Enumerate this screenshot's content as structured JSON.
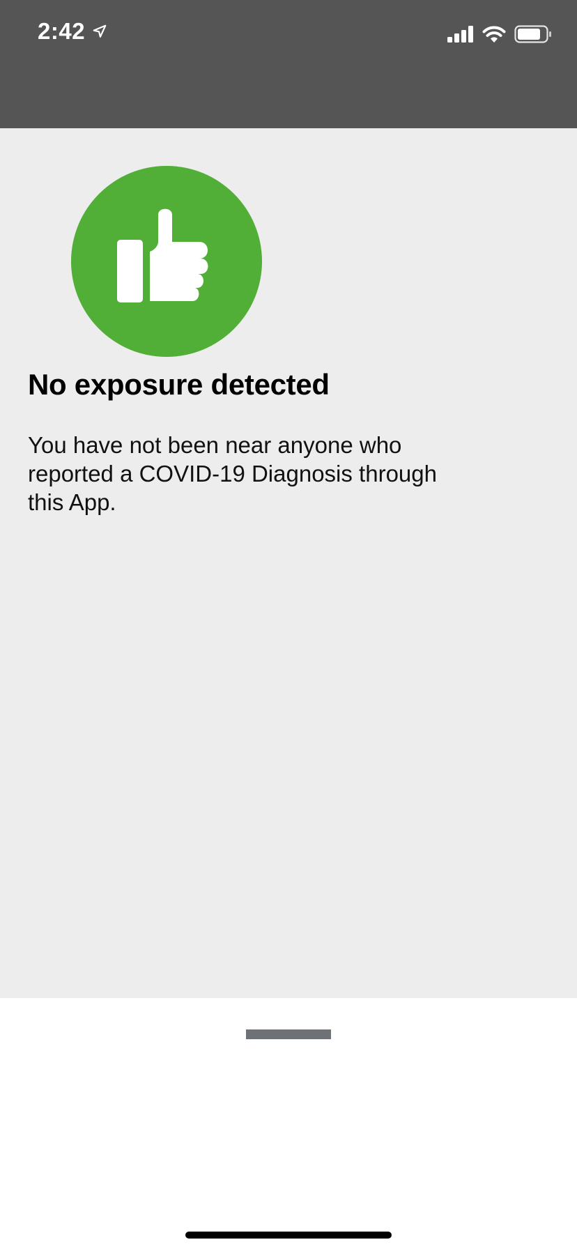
{
  "status_bar": {
    "time": "2:42",
    "icons": [
      "location-arrow-icon",
      "cellular-signal-icon",
      "wifi-icon",
      "battery-icon"
    ],
    "background_color": "#555555"
  },
  "exposure_status": {
    "icon": "thumbs-up-icon",
    "icon_color": "#51ae36",
    "headline": "No exposure detected",
    "message": "You have not been near anyone who reported a COVID-19 Diagnosis through this App."
  },
  "bottom_sheet": {
    "grabber": "sheet-grabber"
  }
}
